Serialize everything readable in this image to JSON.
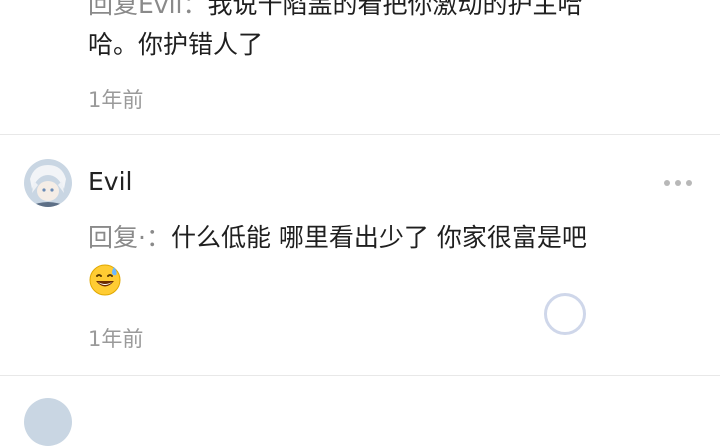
{
  "comments": [
    {
      "reply_prefix": "回复Evil：",
      "text_line1": "我说十陷盖的看把你激动的护主哈",
      "text_line2": "哈。你护错人了",
      "time": "1年前"
    },
    {
      "username": "Evil",
      "reply_prefix": "回复·：",
      "text": "什么低能 哪里看出少了 你家很富是吧",
      "emoji": "sweat-smile-emoji",
      "time": "1年前"
    }
  ],
  "colors": {
    "prefix": "#8a8a8a",
    "time": "#9a9a9a",
    "divider": "#e8e8e8",
    "background": "#ffffff"
  }
}
